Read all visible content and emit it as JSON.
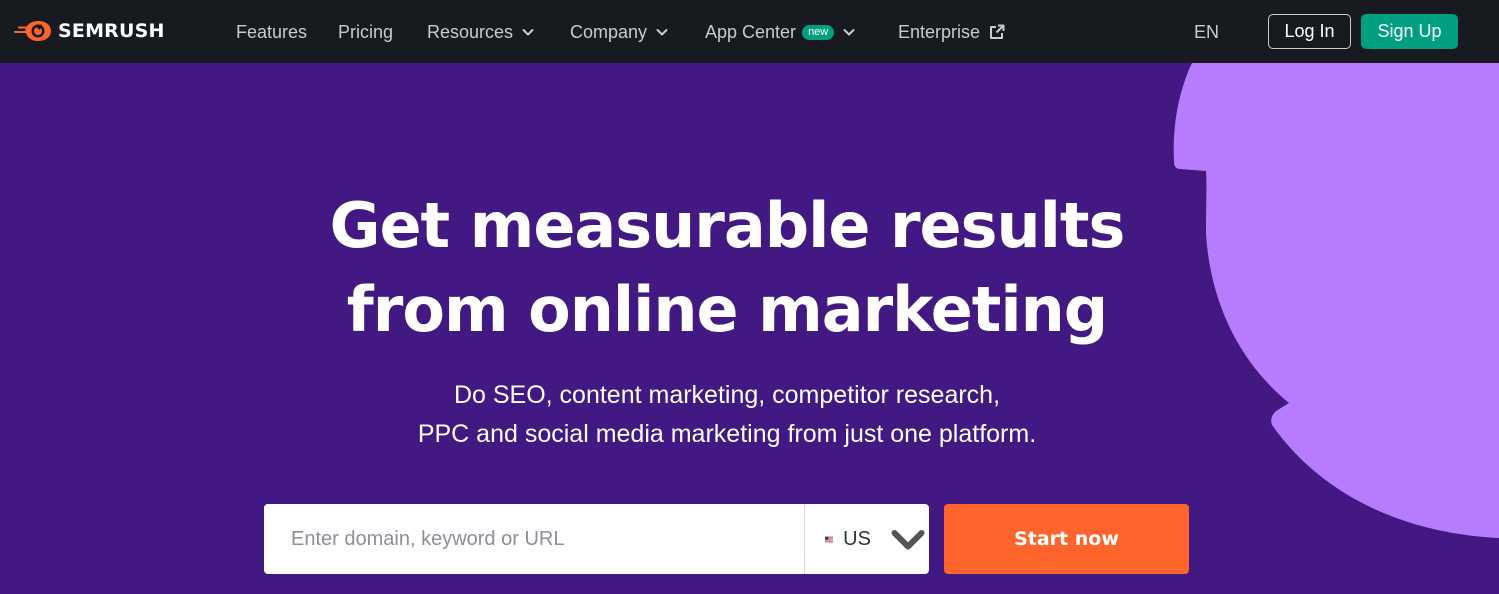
{
  "colors": {
    "nav_bg": "#171a1f",
    "hero_bg": "#421983",
    "decor_shape": "#b77cfd",
    "brand_orange": "#ff642d",
    "accent_green": "#009f81"
  },
  "nav": {
    "logo_text": "SEMRUSH",
    "logo_icon": "semrush-flame-icon",
    "items": [
      {
        "label": "Features"
      },
      {
        "label": "Pricing"
      },
      {
        "label": "Resources",
        "icon": "chevron-down-icon"
      },
      {
        "label": "Company",
        "icon": "chevron-down-icon"
      },
      {
        "label": "App Center",
        "badge": "new",
        "icon": "chevron-down-icon"
      },
      {
        "label": "Enterprise",
        "icon": "external-link-icon"
      }
    ],
    "language": "EN",
    "login_label": "Log In",
    "signup_label": "Sign Up"
  },
  "hero": {
    "title_line1": "Get measurable results",
    "title_line2": "from online marketing",
    "subtitle_line1": "Do SEO, content marketing, competitor research,",
    "subtitle_line2": "PPC and social media marketing from just one platform.",
    "search": {
      "placeholder": "Enter domain, keyword or URL",
      "value": "",
      "database": "US",
      "database_icon": "us-flag-icon"
    },
    "cta_label": "Start now"
  }
}
